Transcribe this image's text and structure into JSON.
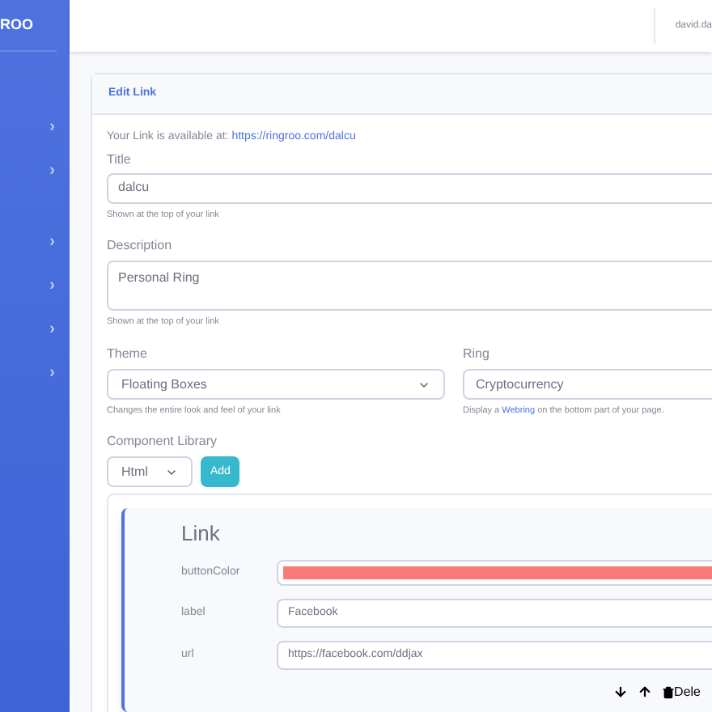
{
  "sidebar": {
    "brand": "ROO",
    "items": [
      {
        "chevron": "›"
      },
      {
        "chevron": "›"
      },
      {
        "chevron": "›"
      },
      {
        "chevron": "›"
      },
      {
        "chevron": "›"
      },
      {
        "chevron": "›"
      }
    ]
  },
  "topbar": {
    "user": "david.da"
  },
  "card": {
    "title": "Edit Link",
    "availability": {
      "text": "Your Link is available at:",
      "link": "https://ringroo.com/dalcu"
    },
    "title_field": {
      "label": "Title",
      "value": "dalcu",
      "hint": "Shown at the top of your link"
    },
    "description_field": {
      "label": "Description",
      "value": "Personal Ring",
      "hint": "Shown at the top of your link"
    },
    "theme": {
      "label": "Theme",
      "value": "Floating Boxes",
      "hint": "Changes the entire look and feel of your link"
    },
    "ring": {
      "label": "Ring",
      "value": "Cryptocurrency",
      "hint_before": "Display a",
      "hint_link": "Webring",
      "hint_after": "on the bottom part of your page."
    },
    "component_library": {
      "label": "Component Library",
      "select": "Html",
      "add_button": "Add"
    },
    "component": {
      "title": "Link",
      "fields": [
        {
          "kind": "color",
          "label": "buttonColor",
          "color": "#f87a78"
        },
        {
          "kind": "text",
          "label": "label",
          "value": "Facebook"
        },
        {
          "kind": "text",
          "label": "url",
          "value": "https://facebook.com/ddjax"
        }
      ],
      "actions": {
        "delete": "Dele"
      }
    }
  }
}
